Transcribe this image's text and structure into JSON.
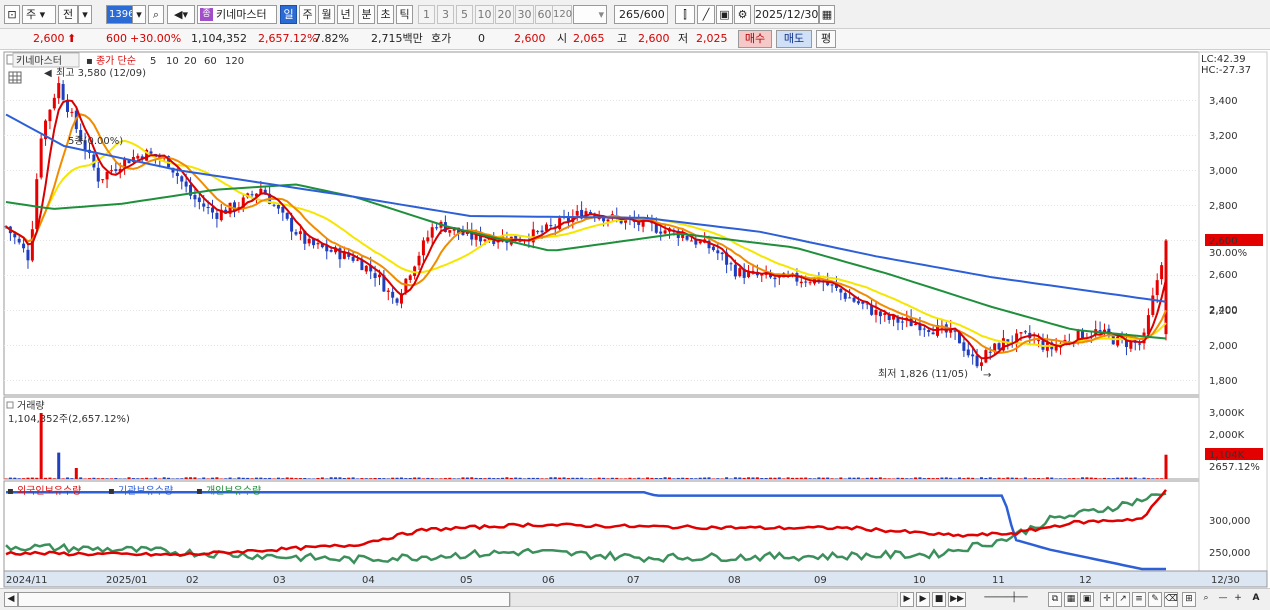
{
  "toolbar": {
    "type_select": "주",
    "prev_button": "전",
    "code": "139670",
    "name": "키네마스터",
    "name_badge": "종",
    "periods": [
      "일",
      "주",
      "월",
      "년",
      "분",
      "초",
      "틱"
    ],
    "intervals": [
      "1",
      "3",
      "5",
      "10",
      "20",
      "30",
      "60",
      "120"
    ],
    "count": "265",
    "count_total": "/600",
    "date": "2025/12/30"
  },
  "quote": {
    "price": "2,600",
    "change": "600",
    "change_rate": "+30.00%",
    "volume": "1,104,352",
    "volume_rate": "2,657.12%",
    "turnover_rate": "7.82%",
    "amount": "2,715백만",
    "hoga_label": "호가",
    "hoga_value": "0",
    "hoga_price": "2,600",
    "open_label": "시",
    "open": "2,065",
    "high_label": "고",
    "high": "2,600",
    "low_label": "저",
    "low": "2,025",
    "buy_button": "매수",
    "sell_button": "매도",
    "eval_button": "평"
  },
  "chart": {
    "legend": {
      "name": "키네마스터",
      "close_label": "종가 단순",
      "ma_periods": [
        "5",
        "10",
        "20",
        "60",
        "120"
      ]
    },
    "lc": "LC:42.39",
    "hc": "HC:-27.37",
    "high_annotation": "최고 3,580 (12/09)",
    "low_annotation": "최저 1,826 (11/05)",
    "ma_annotation": "5종(0.00%)",
    "price_ticks": [
      "3,400",
      "3,200",
      "3,000",
      "2,800",
      "2,600",
      "2,400",
      "2,200",
      "2,000",
      "1,800"
    ],
    "last_price_box": "2,600",
    "last_rate": "30.00%",
    "volume_title": "거래량",
    "volume_value": "1,104,352주(2,657.12%)",
    "volume_ticks": [
      "3,000K",
      "2,000K",
      "1,000K"
    ],
    "volume_box": "1,104K",
    "volume_rate": "2657.12%",
    "holdings_titles": [
      "외국인보유수량",
      "기관보유수량",
      "개인보유수량"
    ],
    "holdings_ticks": [
      "300,000",
      "250,000"
    ],
    "x_labels": [
      "2024/11",
      "2025/01",
      "02",
      "03",
      "04",
      "05",
      "06",
      "07",
      "08",
      "09",
      "10",
      "11",
      "12",
      "12/30"
    ]
  },
  "chart_data": {
    "type": "candlestick",
    "y_range": [
      1750,
      3580
    ],
    "price_path": [
      [
        0,
        2680
      ],
      [
        0.02,
        2500
      ],
      [
        0.03,
        3200
      ],
      [
        0.045,
        3500
      ],
      [
        0.06,
        3250
      ],
      [
        0.08,
        2950
      ],
      [
        0.1,
        3050
      ],
      [
        0.12,
        3100
      ],
      [
        0.14,
        3050
      ],
      [
        0.16,
        2850
      ],
      [
        0.18,
        2750
      ],
      [
        0.2,
        2800
      ],
      [
        0.22,
        2900
      ],
      [
        0.24,
        2720
      ],
      [
        0.26,
        2580
      ],
      [
        0.28,
        2540
      ],
      [
        0.3,
        2500
      ],
      [
        0.32,
        2400
      ],
      [
        0.335,
        2250
      ],
      [
        0.35,
        2450
      ],
      [
        0.37,
        2700
      ],
      [
        0.4,
        2620
      ],
      [
        0.44,
        2610
      ],
      [
        0.46,
        2640
      ],
      [
        0.5,
        2770
      ],
      [
        0.52,
        2730
      ],
      [
        0.55,
        2690
      ],
      [
        0.58,
        2640
      ],
      [
        0.61,
        2550
      ],
      [
        0.63,
        2420
      ],
      [
        0.66,
        2380
      ],
      [
        0.7,
        2380
      ],
      [
        0.73,
        2260
      ],
      [
        0.76,
        2150
      ],
      [
        0.79,
        2120
      ],
      [
        0.82,
        2050
      ],
      [
        0.835,
        1900
      ],
      [
        0.86,
        2020
      ],
      [
        0.88,
        2050
      ],
      [
        0.9,
        1980
      ],
      [
        0.92,
        2050
      ],
      [
        0.94,
        2080
      ],
      [
        0.96,
        2020
      ],
      [
        0.98,
        2010
      ],
      [
        1.0,
        2600
      ]
    ],
    "ma120": [
      [
        0,
        3320
      ],
      [
        0.05,
        3140
      ],
      [
        0.15,
        3000
      ],
      [
        0.3,
        2850
      ],
      [
        0.4,
        2740
      ],
      [
        0.55,
        2730
      ],
      [
        0.65,
        2650
      ],
      [
        0.75,
        2510
      ],
      [
        0.85,
        2390
      ],
      [
        1.0,
        2250
      ]
    ],
    "ma60": [
      [
        0,
        2820
      ],
      [
        0.04,
        2780
      ],
      [
        0.1,
        2810
      ],
      [
        0.18,
        2890
      ],
      [
        0.25,
        2920
      ],
      [
        0.3,
        2850
      ],
      [
        0.38,
        2680
      ],
      [
        0.47,
        2540
      ],
      [
        0.58,
        2640
      ],
      [
        0.68,
        2560
      ],
      [
        0.76,
        2410
      ],
      [
        0.85,
        2220
      ],
      [
        0.92,
        2090
      ],
      [
        1.0,
        2040
      ]
    ],
    "volume_spikes": [
      [
        0.03,
        3000
      ],
      [
        0.045,
        1200
      ],
      [
        0.06,
        500
      ],
      [
        1.0,
        1104
      ]
    ],
    "holdings": {
      "foreign": [
        [
          0,
          250
        ],
        [
          0.15,
          247
        ],
        [
          0.3,
          262
        ],
        [
          0.36,
          285
        ],
        [
          0.45,
          293
        ],
        [
          0.55,
          290
        ],
        [
          0.65,
          288
        ],
        [
          0.73,
          288
        ],
        [
          0.82,
          276
        ],
        [
          0.87,
          280
        ],
        [
          0.92,
          296
        ],
        [
          0.98,
          302
        ],
        [
          1.0,
          345
        ]
      ],
      "institution": [
        [
          0,
          342
        ],
        [
          0.55,
          342
        ],
        [
          0.56,
          337
        ],
        [
          0.86,
          337
        ],
        [
          0.87,
          270
        ],
        [
          0.9,
          255
        ],
        [
          1.0,
          218
        ]
      ],
      "individual": [
        [
          0,
          260
        ],
        [
          0.1,
          255
        ],
        [
          0.3,
          240
        ],
        [
          0.45,
          252
        ],
        [
          0.55,
          243
        ],
        [
          0.7,
          245
        ],
        [
          0.8,
          248
        ],
        [
          0.86,
          270
        ],
        [
          0.9,
          300
        ],
        [
          0.95,
          318
        ],
        [
          1.0,
          340
        ]
      ]
    }
  }
}
